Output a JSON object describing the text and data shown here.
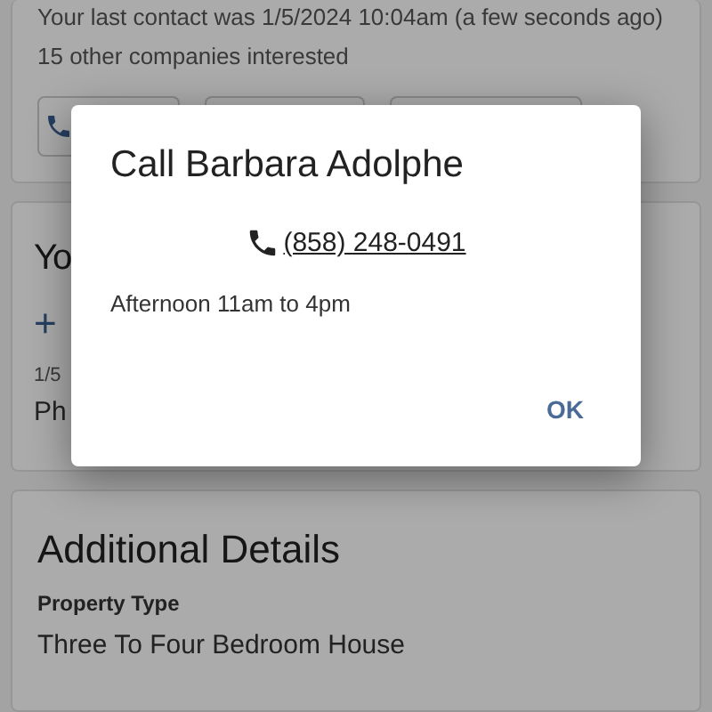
{
  "contact_card": {
    "last_contact": "Your last contact was 1/5/2024 10:04am (a few seconds ago)",
    "interest": "15 other companies interested",
    "buttons": [
      {
        "kind": "call"
      },
      {
        "kind": "blank"
      },
      {
        "kind": "blank"
      }
    ]
  },
  "notes_card": {
    "title": "Yo",
    "add": "+",
    "date": "1/5",
    "entry": "Ph"
  },
  "details_card": {
    "title": "Additional Details",
    "fields": [
      {
        "label": "Property Type",
        "value": "Three To Four Bedroom House"
      }
    ]
  },
  "dialog": {
    "title": "Call Barbara Adolphe",
    "phone": "(858) 248-0491",
    "note": "Afternoon 11am to 4pm",
    "button": "OK"
  }
}
